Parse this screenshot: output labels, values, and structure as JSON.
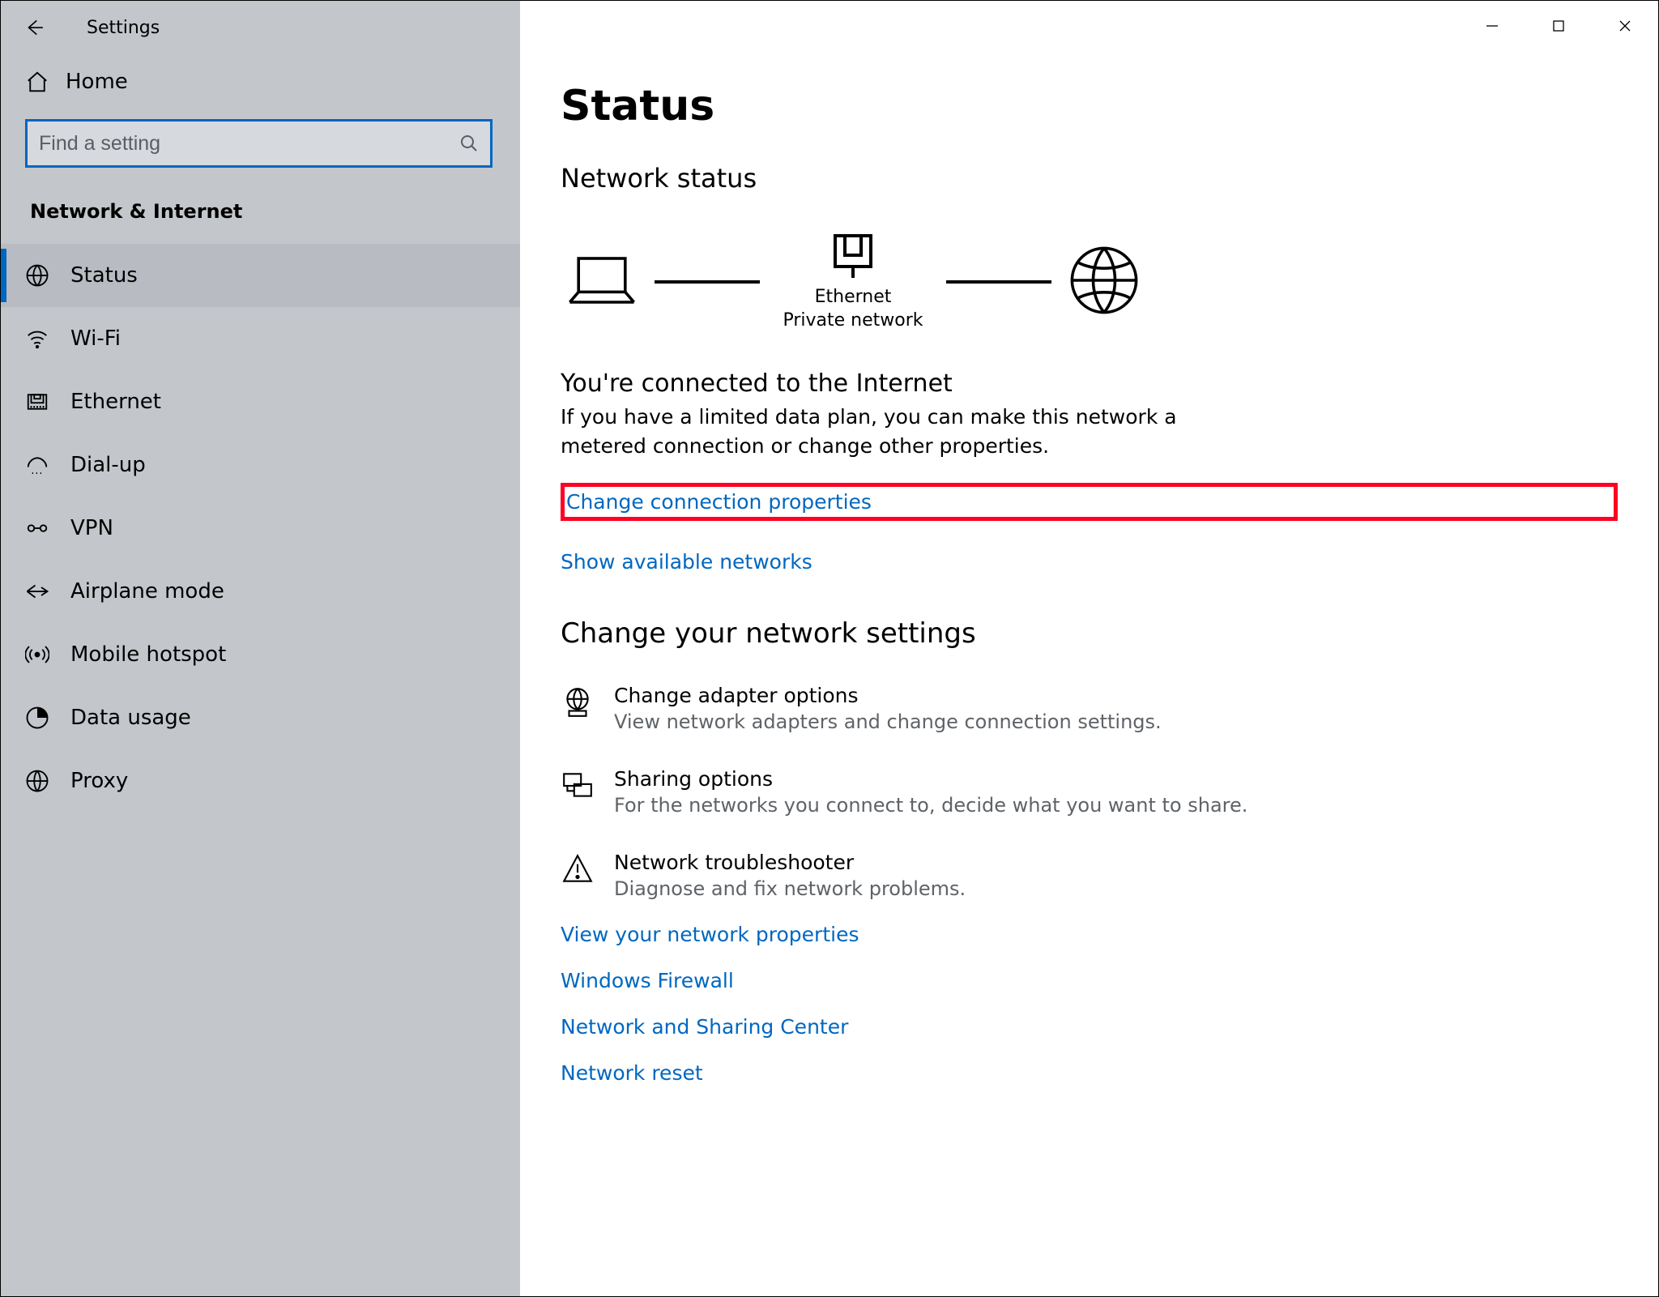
{
  "window": {
    "title": "Settings"
  },
  "sidebar": {
    "home_label": "Home",
    "search_placeholder": "Find a setting",
    "category_label": "Network & Internet",
    "items": [
      {
        "label": "Status",
        "active": true
      },
      {
        "label": "Wi-Fi"
      },
      {
        "label": "Ethernet"
      },
      {
        "label": "Dial-up"
      },
      {
        "label": "VPN"
      },
      {
        "label": "Airplane mode"
      },
      {
        "label": "Mobile hotspot"
      },
      {
        "label": "Data usage"
      },
      {
        "label": "Proxy"
      }
    ]
  },
  "main": {
    "page_title": "Status",
    "network_status_heading": "Network status",
    "diagram": {
      "adapter_label": "Ethernet",
      "network_type_label": "Private network"
    },
    "connected_heading": "You're connected to the Internet",
    "connected_desc": "If you have a limited data plan, you can make this network a metered connection or change other properties.",
    "link_change_connection": "Change connection properties",
    "link_show_networks": "Show available networks",
    "change_settings_heading": "Change your network settings",
    "options": [
      {
        "title": "Change adapter options",
        "sub": "View network adapters and change connection settings."
      },
      {
        "title": "Sharing options",
        "sub": "For the networks you connect to, decide what you want to share."
      },
      {
        "title": "Network troubleshooter",
        "sub": "Diagnose and fix network problems."
      }
    ],
    "bottom_links": {
      "view_properties": "View your network properties",
      "firewall": "Windows Firewall",
      "sharing_center": "Network and Sharing Center",
      "reset": "Network reset"
    }
  }
}
